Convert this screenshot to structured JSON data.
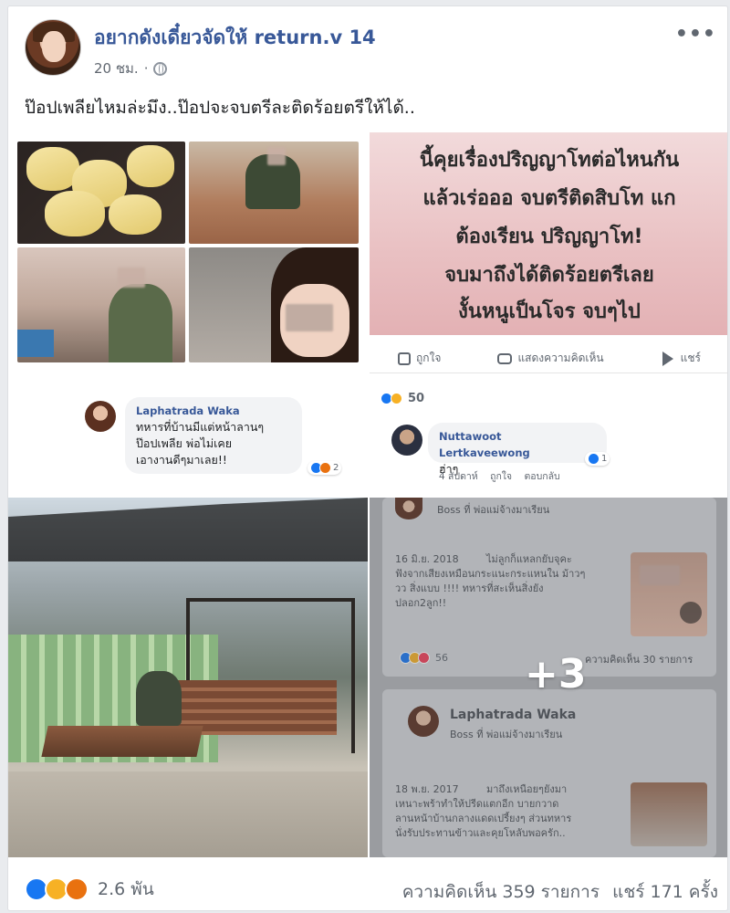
{
  "post": {
    "author": "อยากดังเดี๋ยวจัดให้ return.v 14",
    "time": "20 ชม.",
    "separator": "·",
    "caption": "ป๊อปเพลียไหมล่ะมึง..ป๊อปจะจบตรีละติดร้อยตรีให้ได้.."
  },
  "tile_tl": {
    "comment": {
      "author": "Laphatrada Waka",
      "lines": [
        "ทหารที่บ้านมีแต่หน้าลานๆ",
        "ป๊อปเพลีย พ่อไม่เคย",
        "เอางานดีๆมาเลย!!"
      ],
      "reaction_count": "2"
    }
  },
  "tile_tr": {
    "text_lines": [
      "นี้คุยเรื่องปริญญาโทต่อไหนกัน",
      "แล้วเร่อออ จบตรีติดสิบโท แก",
      "ต้องเรียน ปริญญาโท!",
      "จบมาถึงได้ติดร้อยตรีเลย",
      "งั้นหนูเป็นโจร จบๆไป"
    ],
    "actions": [
      "ถูกใจ",
      "แสดงความคิดเห็น",
      "แชร์"
    ],
    "reaction_count": "50",
    "comment": {
      "author": "Nuttawoot Lertkaveewong",
      "text": "ฮ่าๆ",
      "reaction_count": "1",
      "meta": [
        "4 สัปดาห์",
        "ถูกใจ",
        "ตอบกลับ"
      ]
    }
  },
  "tile_br": {
    "top_sub": "Boss ที่ พ่อแม่จ้างมาเรียน",
    "entry1": {
      "date": "16 มิ.ย. 2018",
      "lines": [
        "ไม่ลูกก็แหลกยับจุคะ",
        "ฟังจากเสียงเหมือนกระแนะกระแหนใน ม้าวๆ",
        "วว สิ่งแบบ !!!! ทหารที่สะเห็นสิ่งยัง",
        "ปลอก2ลูก!!"
      ],
      "reactions": "56",
      "comments": "ความคิดเห็น 30 รายการ"
    },
    "entry2": {
      "author": "Laphatrada Waka",
      "sub": "Boss ที่ พ่อแม่จ้างมาเรียน",
      "date": "18 พ.ย. 2017",
      "lines": [
        "มาถึงเหนือยๆยังมา",
        "เหนาะพร้าทำให้ปรีดแตกอีก บายกวาด",
        "ลานหน้าบ้านกลางแดดเปรี้ยงๆ ส่วนทหาร",
        "นั่งรับประทานข้าวและคุยโหลับพอครัก.."
      ]
    },
    "more": "+3"
  },
  "footer": {
    "reaction_count": "2.6 พัน",
    "comments": "ความคิดเห็น 359 รายการ",
    "shares": "แชร์ 171 ครั้ง"
  },
  "icons": {
    "privacy": "globe-icon",
    "menu": "more-icon",
    "reactions": [
      "like-icon",
      "haha-icon",
      "angry-icon"
    ]
  },
  "colors": {
    "name_blue": "#385898",
    "like": "#1877f2",
    "haha": "#f7b125",
    "angry": "#e9710f"
  }
}
